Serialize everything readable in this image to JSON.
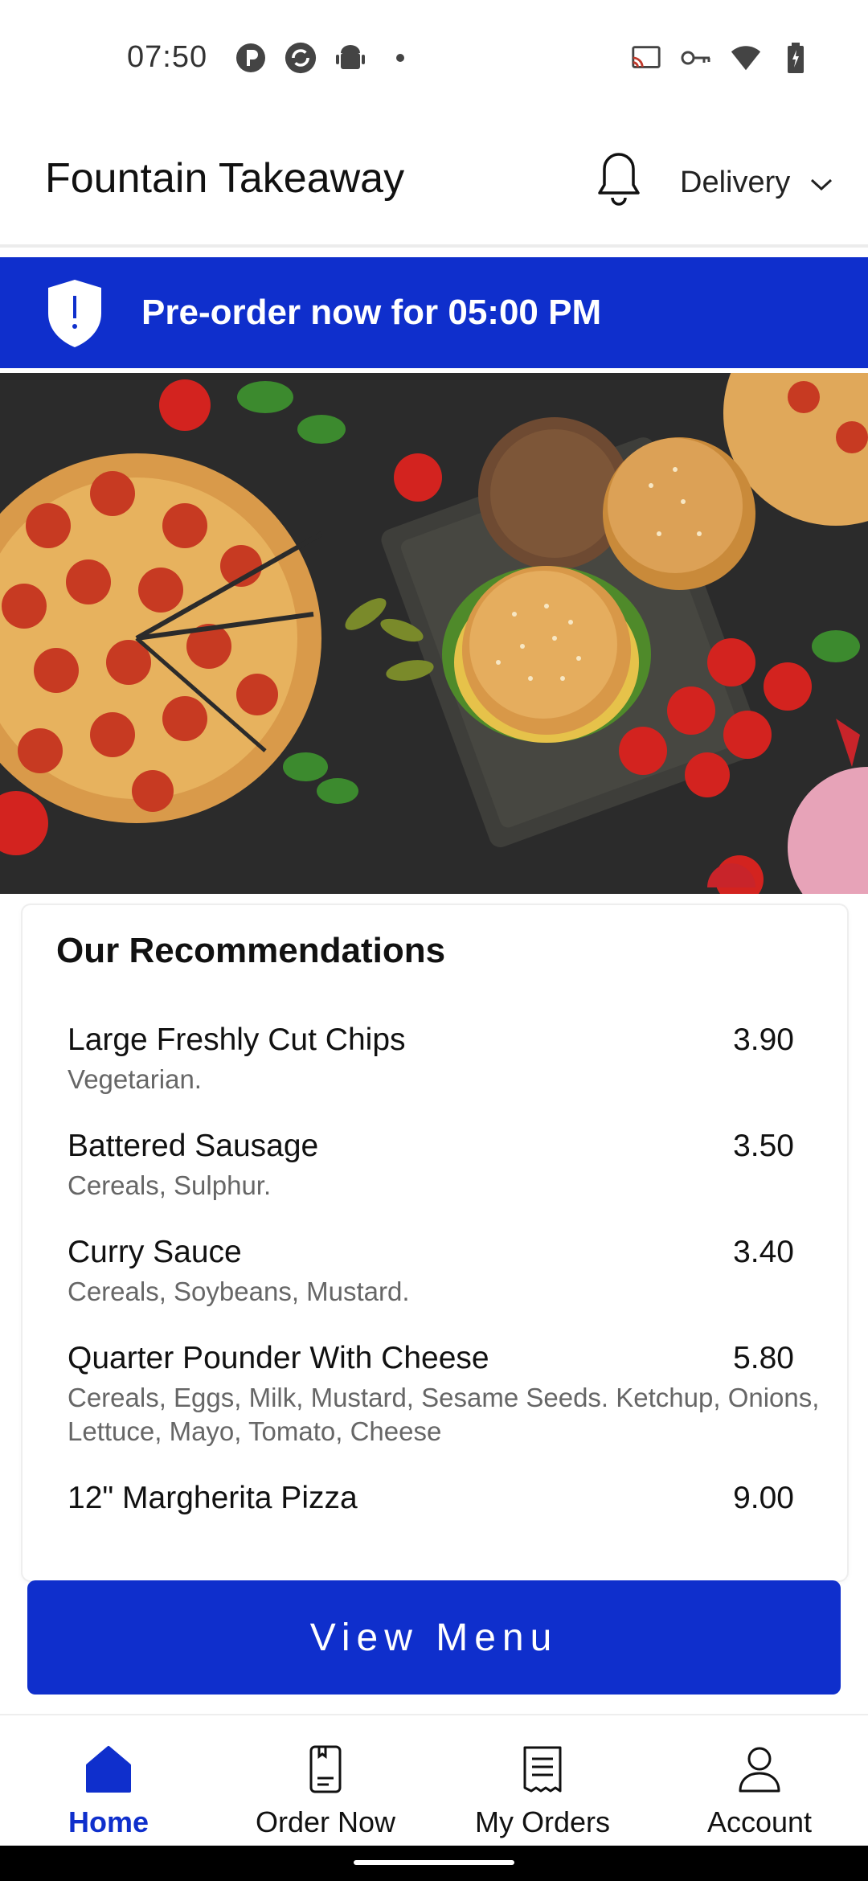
{
  "status_bar": {
    "time": "07:50",
    "left_icons": [
      "p-circle-icon",
      "sync-icon",
      "android-icon",
      "dot-icon"
    ],
    "right_icons": [
      "cast-icon",
      "key-icon",
      "wifi-icon",
      "battery-icon"
    ]
  },
  "header": {
    "title": "Fountain Takeaway",
    "delivery_mode": "Delivery"
  },
  "banner": {
    "text": "Pre-order now for 05:00 PM",
    "icon": "shield-alert-icon"
  },
  "recommendations": {
    "title": "Our Recommendations",
    "items": [
      {
        "name": "Large Freshly Cut Chips",
        "desc": "Vegetarian.",
        "price": "3.90"
      },
      {
        "name": "Battered Sausage",
        "desc": "Cereals, Sulphur.",
        "price": "3.50"
      },
      {
        "name": "Curry Sauce",
        "desc": "Cereals, Soybeans, Mustard.",
        "price": "3.40"
      },
      {
        "name": "Quarter Pounder With Cheese",
        "desc": "Cereals, Eggs, Milk, Mustard, Sesame Seeds. Ketchup, Onions, Lettuce, Mayo, Tomato, Cheese",
        "price": "5.80"
      },
      {
        "name": "12\" Margherita Pizza",
        "desc": "",
        "price": "9.00"
      }
    ]
  },
  "cta": {
    "view_menu": "View Menu"
  },
  "bottom_nav": {
    "items": [
      {
        "label": "Home",
        "icon": "home-icon",
        "active": true
      },
      {
        "label": "Order Now",
        "icon": "order-icon",
        "active": false
      },
      {
        "label": "My Orders",
        "icon": "receipt-icon",
        "active": false
      },
      {
        "label": "Account",
        "icon": "user-icon",
        "active": false
      }
    ]
  },
  "colors": {
    "brand": "#0f2fcc",
    "text": "#111111",
    "muted": "#666666"
  }
}
